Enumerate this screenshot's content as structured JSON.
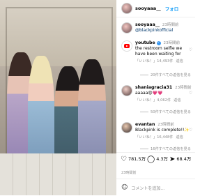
{
  "post_image": {
    "alt": ""
  },
  "header": {
    "username": "sooyaaa__",
    "follow_label": "フォロ"
  },
  "caption": {
    "username": "sooyaaa__",
    "timestamp": "23時間前",
    "text": "@blackpinkofficial"
  },
  "comments": [
    {
      "username": "youtube",
      "timestamp": "23時間前",
      "text": "the restroom selfie we have been waiting for",
      "likes": "「いいね！」14,493件",
      "reply_label": "返信",
      "replies_label": "20件すべての返信を見る"
    },
    {
      "username": "shaniagracia31",
      "timestamp": "23時間前",
      "text": "aaaaa😍💗💗",
      "likes": "「いいね！」4,062件",
      "reply_label": "返信",
      "replies_label": "50件すべての返信を見る"
    },
    {
      "username": "evantan",
      "timestamp": "23時間前",
      "text": "Blackpink is complete!!✨",
      "likes": "「いいね！」16,448件",
      "reply_label": "返信",
      "replies_label": "16件すべての返信を見る"
    }
  ],
  "actions": {
    "likes": "781.5万",
    "comments": "4.3万",
    "shares": "68.4万"
  },
  "date": "23時間前",
  "compose": {
    "placeholder": "コメントを追加..."
  },
  "colors": {
    "link": "#00376b",
    "follow": "#0095f6",
    "youtube": "#ff0000"
  }
}
